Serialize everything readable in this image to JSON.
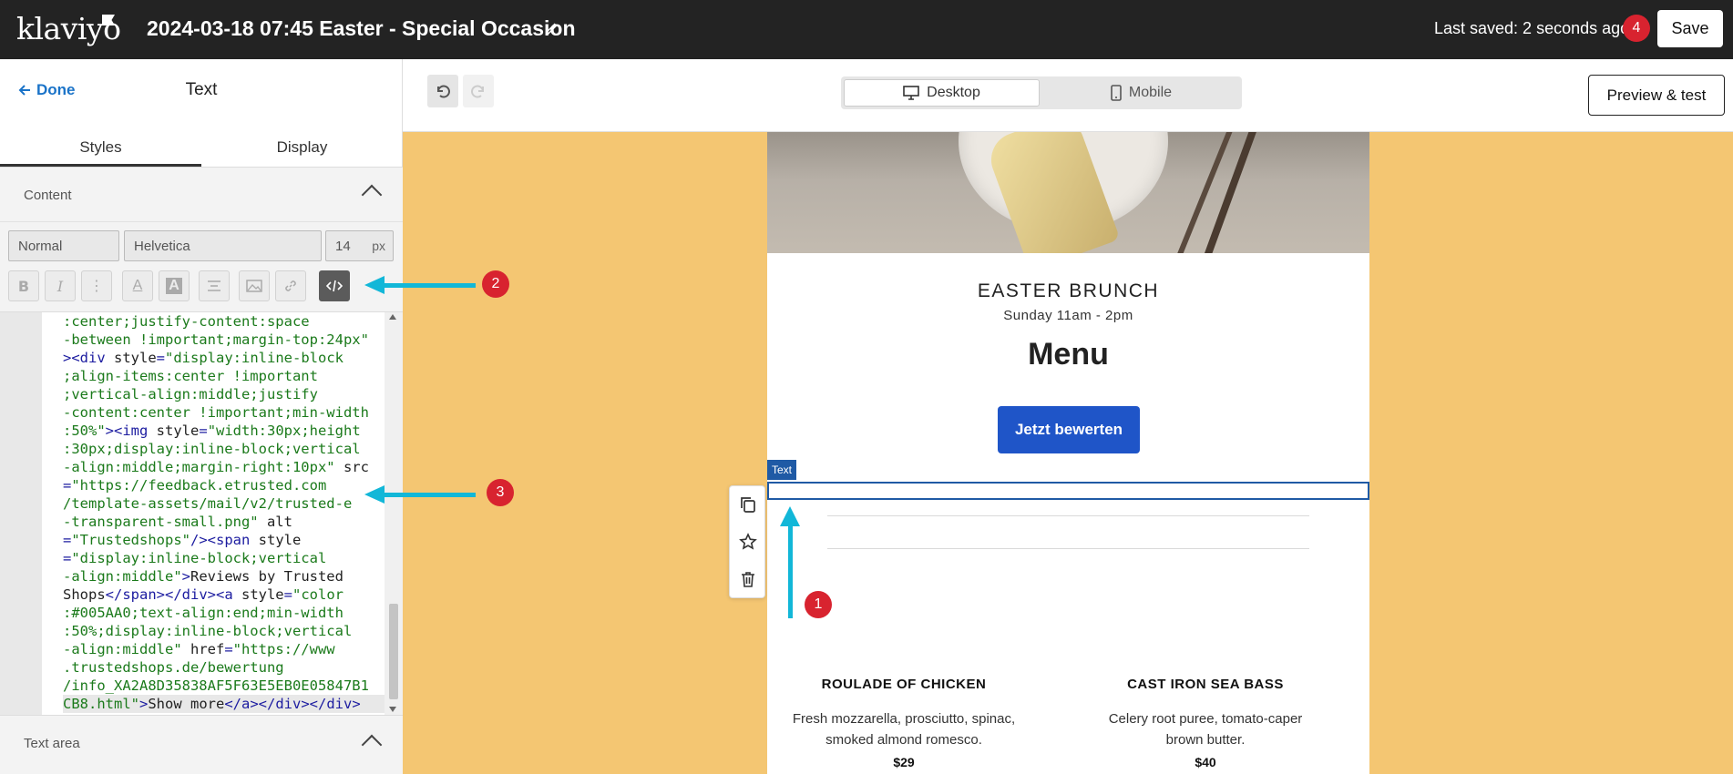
{
  "topbar": {
    "logo": "klaviyo",
    "title": "2024-03-18 07:45 Easter - Special Occasion",
    "last_saved": "Last saved: 2 seconds ago",
    "notification_count": "4",
    "save_label": "Save"
  },
  "left_panel": {
    "done_label": "Done",
    "title": "Text",
    "tabs": [
      {
        "label": "Styles",
        "active": true
      },
      {
        "label": "Display",
        "active": false
      }
    ],
    "content_section": "Content",
    "font_style": "Normal",
    "font_family": "Helvetica",
    "font_size": "14",
    "font_unit": "px",
    "toolbar_icons": [
      "bold-icon",
      "italic-icon",
      "more-icon",
      "text-color-icon",
      "highlight-icon",
      "align-icon",
      "image-icon",
      "link-icon",
      "code-icon"
    ],
    "textarea_section": "Text area"
  },
  "code": {
    "lines": [
      [
        [
          "c-val",
          ":center;justify-content:space"
        ]
      ],
      [
        [
          "c-val",
          "-between !important;margin-top:24px\""
        ]
      ],
      [
        [
          "c-tag",
          "><div "
        ],
        [
          "c-attr",
          "style"
        ],
        [
          "c-tag",
          "="
        ],
        [
          "c-val",
          "\"display:inline-block"
        ]
      ],
      [
        [
          "c-val",
          ";align-items:center !important"
        ]
      ],
      [
        [
          "c-val",
          ";vertical-align:middle;justify"
        ]
      ],
      [
        [
          "c-val",
          "-content:center !important;min-width"
        ]
      ],
      [
        [
          "c-val",
          ":50%\""
        ],
        [
          "c-tag",
          "><img "
        ],
        [
          "c-attr",
          "style"
        ],
        [
          "c-tag",
          "="
        ],
        [
          "c-val",
          "\"width:30px;height"
        ]
      ],
      [
        [
          "c-val",
          ":30px;display:inline-block;vertical"
        ]
      ],
      [
        [
          "c-val",
          "-align:middle;margin-right:10px\" "
        ],
        [
          "c-attr",
          "src"
        ]
      ],
      [
        [
          "c-tag",
          "="
        ],
        [
          "c-val",
          "\"https://feedback.etrusted.com"
        ]
      ],
      [
        [
          "c-val",
          "/template-assets/mail/v2/trusted-e"
        ]
      ],
      [
        [
          "c-val",
          "-transparent-small.png\" "
        ],
        [
          "c-attr",
          "alt"
        ]
      ],
      [
        [
          "c-tag",
          "="
        ],
        [
          "c-val",
          "\"Trustedshops\""
        ],
        [
          "c-tag",
          "/><span "
        ],
        [
          "c-attr",
          "style"
        ]
      ],
      [
        [
          "c-tag",
          "="
        ],
        [
          "c-val",
          "\"display:inline-block;vertical"
        ]
      ],
      [
        [
          "c-val",
          "-align:middle\""
        ],
        [
          "c-tag",
          ">"
        ],
        [
          "c-text",
          "Reviews by Trusted"
        ]
      ],
      [
        [
          "c-text",
          "Shops"
        ],
        [
          "c-tag",
          "</span></div><a "
        ],
        [
          "c-attr",
          "style"
        ],
        [
          "c-tag",
          "="
        ],
        [
          "c-val",
          "\"color"
        ]
      ],
      [
        [
          "c-val",
          ":#005AA0;text-align:end;min-width"
        ]
      ],
      [
        [
          "c-val",
          ":50%;display:inline-block;vertical"
        ]
      ],
      [
        [
          "c-val",
          "-align:middle\" "
        ],
        [
          "c-attr",
          "href"
        ],
        [
          "c-tag",
          "="
        ],
        [
          "c-val",
          "\"https://www"
        ]
      ],
      [
        [
          "c-val",
          ".trustedshops.de/bewertung"
        ]
      ],
      [
        [
          "c-val",
          "/info_XA2A8D35838AF5F63E5EB0E05847B1"
        ]
      ],
      [
        [
          "c-val",
          "CB8.html\""
        ],
        [
          "c-tag",
          ">"
        ],
        [
          "c-text",
          "Show more"
        ],
        [
          "c-tag",
          "</a></div></div>"
        ]
      ]
    ]
  },
  "canvas_toolbar": {
    "desktop_label": "Desktop",
    "mobile_label": "Mobile",
    "preview_label": "Preview & test"
  },
  "email": {
    "heading": "EASTER BRUNCH",
    "time": "Sunday 11am - 2pm",
    "menu_title": "Menu",
    "cta_label": "Jetzt bewerten",
    "selected_block_tag": "Text",
    "dishes": [
      {
        "title": "ROULADE OF CHICKEN",
        "desc_line1": "Fresh mozzarella, prosciutto, spinac,",
        "desc_line2": "smoked almond romesco.",
        "price": "$29"
      },
      {
        "title": "CAST IRON SEA BASS",
        "desc_line1": "Celery root puree, tomato-caper",
        "desc_line2": "brown butter.",
        "price": "$40"
      }
    ]
  },
  "annotations": {
    "badge1": "1",
    "badge2": "2",
    "badge3": "3"
  },
  "colors": {
    "accent_blue": "#1f55c8",
    "annotation_cyan": "#12b7d8",
    "badge_red": "#d8232f",
    "canvas_bg": "#f4c672"
  }
}
